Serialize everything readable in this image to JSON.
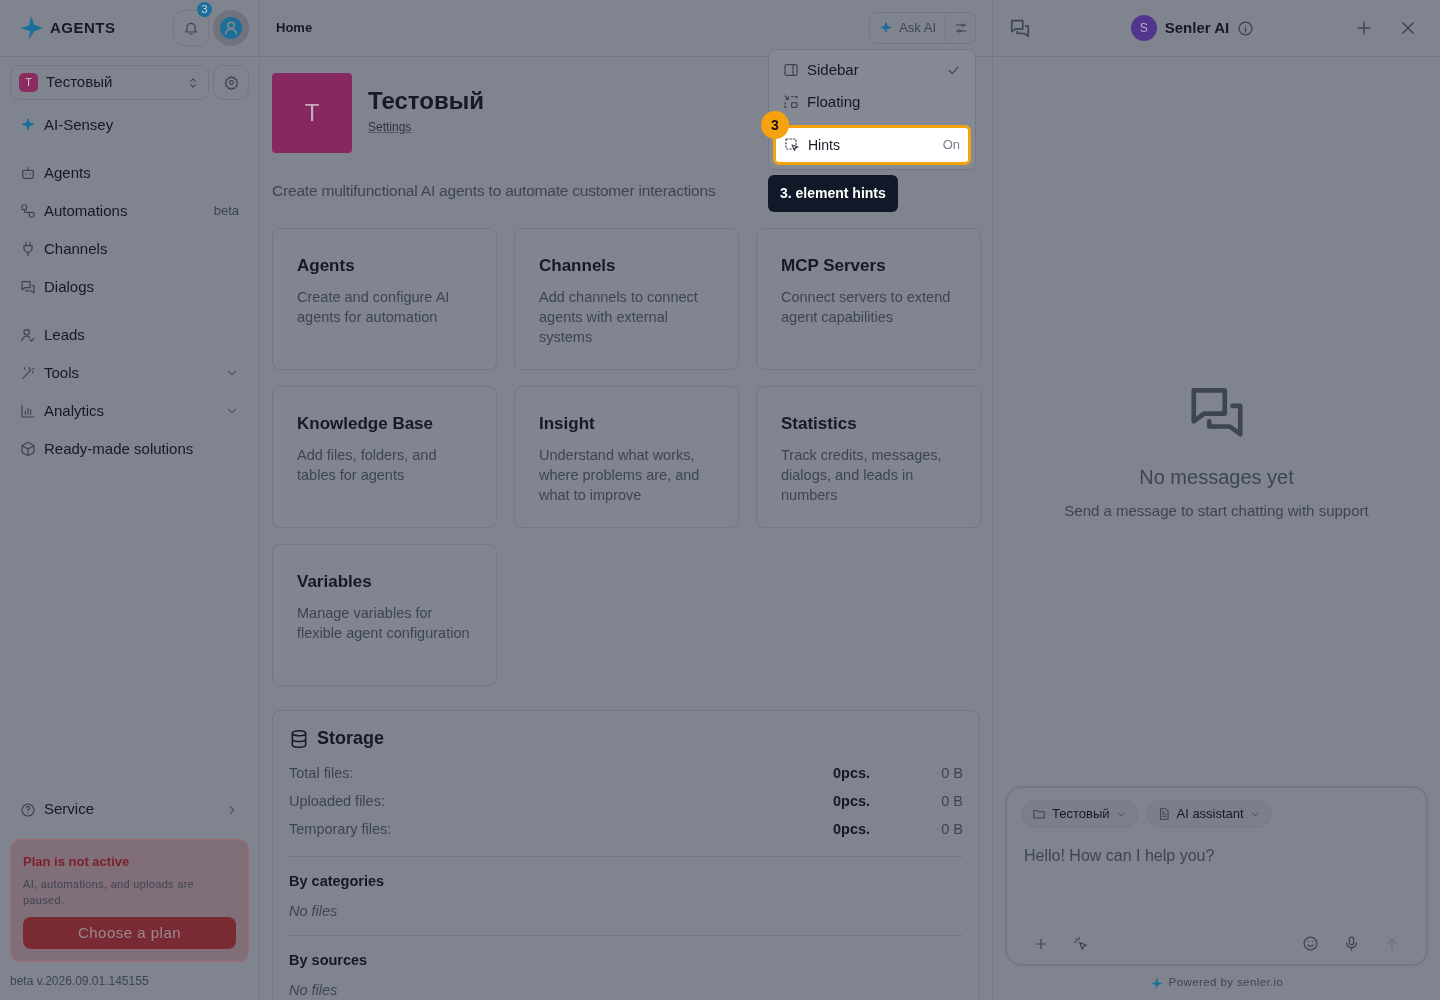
{
  "app": {
    "logo_text": "AGENTS",
    "notification_count": "3"
  },
  "workspace": {
    "initial": "T",
    "name": "Тестовый"
  },
  "sidebar": {
    "groups": [
      [
        {
          "label": "AI-Sensey",
          "kind": "link"
        }
      ],
      [
        {
          "label": "Agents",
          "kind": "link"
        },
        {
          "label": "Automations",
          "kind": "link",
          "badge": "beta"
        },
        {
          "label": "Channels",
          "kind": "link"
        },
        {
          "label": "Dialogs",
          "kind": "link"
        }
      ],
      [
        {
          "label": "Leads",
          "kind": "link"
        },
        {
          "label": "Tools",
          "kind": "submenu"
        },
        {
          "label": "Analytics",
          "kind": "submenu"
        },
        {
          "label": "Ready-made solutions",
          "kind": "link"
        }
      ]
    ],
    "service": {
      "label": "Service",
      "kind": "flyout"
    }
  },
  "plan_notice": {
    "title": "Plan is not active",
    "text": "AI, automations, and uploads are paused.",
    "button": "Choose a plan"
  },
  "version": "beta v.2026.09.01.145155",
  "header": {
    "breadcrumb": "Home",
    "ask_ai": "Ask AI"
  },
  "ai_menu": {
    "items": [
      {
        "label": "Sidebar",
        "checked": true,
        "highlighted": false
      },
      {
        "label": "Floating",
        "checked": false,
        "highlighted": false
      },
      {
        "label": "Hints",
        "checked": false,
        "value": "On",
        "highlighted": true
      }
    ],
    "step_badge": "3",
    "tooltip": "3. element hints"
  },
  "workspace_page": {
    "initial": "T",
    "title": "Тестовый",
    "settings_link": "Settings",
    "description": "Create multifunctional AI agents to automate customer interactions",
    "cards": [
      {
        "title": "Agents",
        "text": "Create and configure AI agents for automation"
      },
      {
        "title": "Channels",
        "text": "Add channels to connect agents with external systems"
      },
      {
        "title": "MCP Servers",
        "text": "Connect servers to extend agent capabilities"
      },
      {
        "title": "Knowledge Base",
        "text": "Add files, folders, and tables for agents"
      },
      {
        "title": "Insight",
        "text": "Understand what works, where problems are, and what to improve"
      },
      {
        "title": "Statistics",
        "text": "Track credits, messages, dialogs, and leads in numbers"
      },
      {
        "title": "Variables",
        "text": "Manage variables for flexible agent configuration"
      }
    ]
  },
  "storage": {
    "title": "Storage",
    "rows": [
      {
        "label": "Total files:",
        "count": "0pcs.",
        "size": "0 B"
      },
      {
        "label": "Uploaded files:",
        "count": "0pcs.",
        "size": "0 B"
      },
      {
        "label": "Temporary files:",
        "count": "0pcs.",
        "size": "0 B"
      }
    ],
    "sections": [
      {
        "title": "By categories",
        "empty": "No files"
      },
      {
        "title": "By sources",
        "empty": "No files"
      }
    ]
  },
  "chat": {
    "avatar": "S",
    "title": "Senler AI",
    "empty_title": "No messages yet",
    "empty_text": "Send a message to start chatting with support",
    "chips": [
      "Тестовый",
      "AI assistant"
    ],
    "placeholder": "Hello! How can I help you?",
    "footer": "Powered by senler.io"
  }
}
